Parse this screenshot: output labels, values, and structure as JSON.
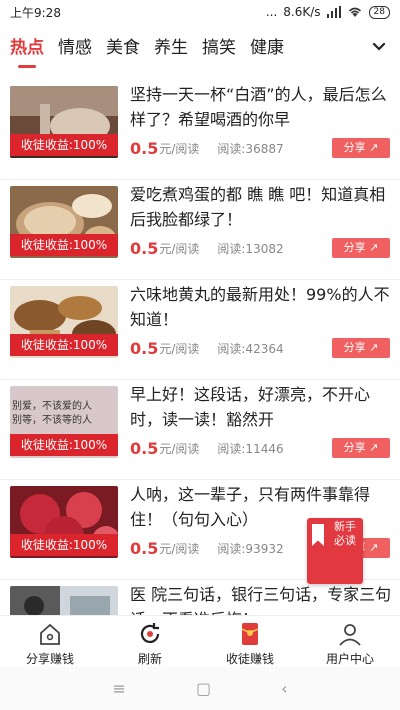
{
  "status_bar": {
    "time": "上午9:28",
    "dots": "...",
    "speed": "8.6K/s",
    "battery": "28"
  },
  "tabs": [
    {
      "label": "热点",
      "active": true
    },
    {
      "label": "情感",
      "active": false
    },
    {
      "label": "美食",
      "active": false
    },
    {
      "label": "养生",
      "active": false
    },
    {
      "label": "搞笑",
      "active": false
    },
    {
      "label": "健康",
      "active": false
    }
  ],
  "colors": {
    "accent": "#e03c3c",
    "badge": "#d9252b",
    "share": "#f06060"
  },
  "feed": {
    "items": [
      {
        "title": "坚持一天一杯“白酒”的人，最后怎么样了？希望喝酒的你早",
        "badge": "收徒收益:100%",
        "price": "0.5",
        "unit": "元/阅读",
        "reads": "阅读:36887",
        "share": "分享"
      },
      {
        "title": "爱吃煮鸡蛋的都  瞧  瞧  吧！知道真相后我脸都绿了！",
        "badge": "收徒收益:100%",
        "price": "0.5",
        "unit": "元/阅读",
        "reads": "阅读:13082",
        "share": "分享"
      },
      {
        "title": "六味地黄丸的最新用处！99%的人不知道！",
        "badge": "收徒收益:100%",
        "price": "0.5",
        "unit": "元/阅读",
        "reads": "阅读:42364",
        "share": "分享"
      },
      {
        "title": "早上好！这段话，好漂亮，不开心时，读一读！豁然开",
        "badge": "收徒收益:100%",
        "price": "0.5",
        "unit": "元/阅读",
        "reads": "阅读:11446",
        "share": "分享",
        "thumb_text": "别爱，不该爱的人\n别等，不该等的人"
      },
      {
        "title": "人呐，这一辈子，只有两件事靠得住！（句句入心）",
        "badge": "收徒收益:100%",
        "price": "0.5",
        "unit": "元/阅读",
        "reads": "阅读:93932",
        "share": "分享"
      },
      {
        "title": "医  院三句话，银行三句话，专家三句话，不看准后悔！",
        "badge": "",
        "price": "",
        "unit": "",
        "reads": "",
        "share": ""
      }
    ]
  },
  "float_badge": {
    "text": "新手必读"
  },
  "bottom_nav": [
    {
      "label": "分享赚钱",
      "icon": "house-icon"
    },
    {
      "label": "刷新",
      "icon": "refresh-icon"
    },
    {
      "label": "收徒赚钱",
      "icon": "red-envelope-icon"
    },
    {
      "label": "用户中心",
      "icon": "user-icon"
    }
  ],
  "system_nav": {
    "menu": "≡",
    "home": "▢",
    "back": "‹"
  }
}
